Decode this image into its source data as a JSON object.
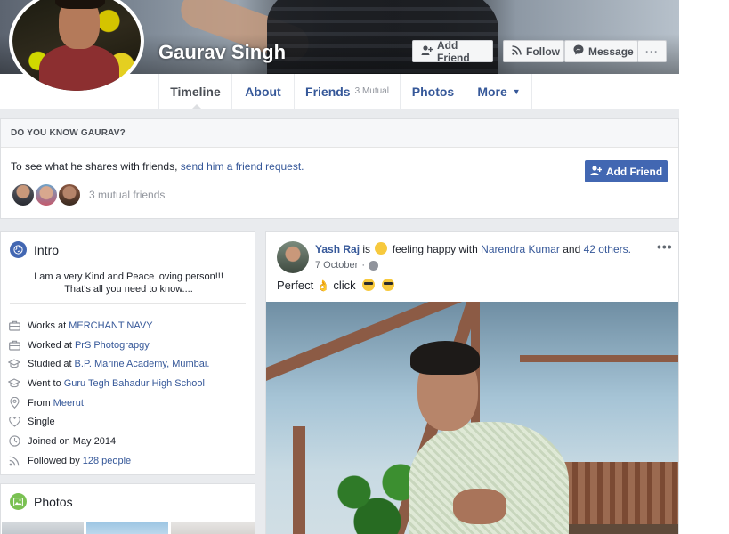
{
  "profile": {
    "name": "Gaurav Singh",
    "actions": {
      "add_friend": "Add Friend",
      "follow": "Follow",
      "message": "Message",
      "more": "···"
    }
  },
  "nav": {
    "tabs": [
      {
        "label": "Timeline"
      },
      {
        "label": "About"
      },
      {
        "label": "Friends",
        "sub": "3 Mutual"
      },
      {
        "label": "Photos"
      },
      {
        "label": "More",
        "caret": "▼"
      }
    ]
  },
  "know": {
    "header": "DO YOU KNOW GAURAV?",
    "text_prefix": "To see what he shares with friends, ",
    "link": "send him a friend request.",
    "button": "Add Friend",
    "mutual": "3 mutual friends"
  },
  "intro": {
    "title": "Intro",
    "bio_line1": "I am a very Kind and Peace loving person!!!",
    "bio_line2": "That's all you need to know....",
    "items": [
      {
        "icon": "briefcase-icon",
        "text": "Works at",
        "link": "MERCHANT NAVY"
      },
      {
        "icon": "briefcase-icon",
        "text": "Worked at",
        "link": "PrS Photograpgy"
      },
      {
        "icon": "graduation-cap-icon",
        "text": "Studied at",
        "link": "B.P. Marine Academy, Mumbai."
      },
      {
        "icon": "graduation-cap-icon",
        "text": "Went to",
        "link": "Guru Tegh Bahadur High School"
      },
      {
        "icon": "location-pin-icon",
        "text": "From",
        "link": "Meerut"
      },
      {
        "icon": "heart-icon",
        "text": "Single",
        "link": ""
      },
      {
        "icon": "clock-icon",
        "text": "Joined on May 2014",
        "link": ""
      },
      {
        "icon": "rss-icon",
        "text": "Followed by",
        "link": "128 people"
      }
    ]
  },
  "photos": {
    "title": "Photos"
  },
  "post": {
    "author": "Yash Raj",
    "is": "is",
    "feeling": "feeling happy with",
    "tagged": "Narendra Kumar",
    "and": "and",
    "others": "42 others.",
    "date": "7 October",
    "dot": "·",
    "options": "•••",
    "text": "Perfect",
    "click": "click",
    "ok_emoji": "👌"
  },
  "colors": {
    "brand": "#4267b2",
    "link": "#365899",
    "background": "#e9ebee"
  }
}
